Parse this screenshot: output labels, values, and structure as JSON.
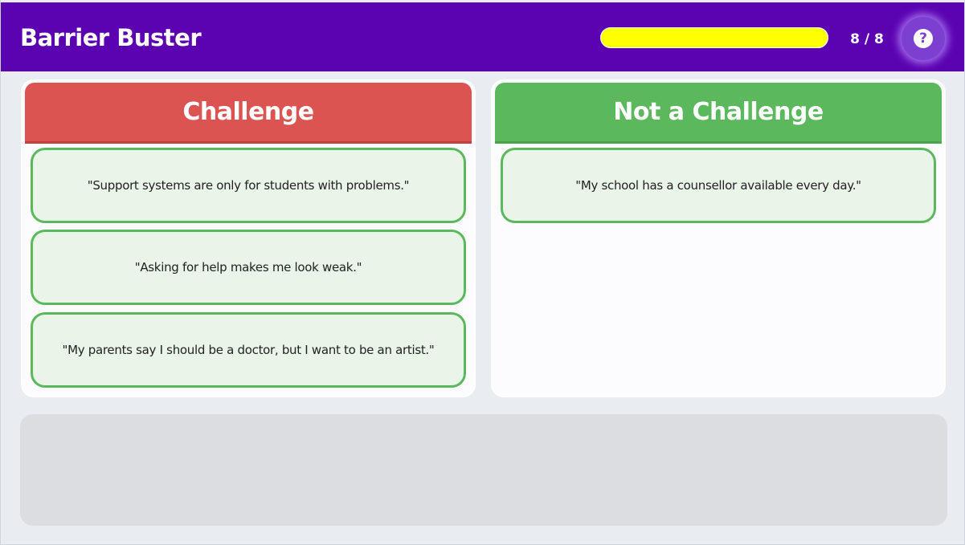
{
  "header": {
    "title": "Barrier Buster",
    "score": "8 / 8",
    "progress_fraction": 1.0,
    "help_icon": "question-circle-icon"
  },
  "columns": {
    "challenge": {
      "heading": "Challenge",
      "cards": [
        "\"Support systems are only for students with problems.\"",
        "\"Asking for help makes me look weak.\"",
        "\"My parents say I should be a doctor, but I want to be an artist.\""
      ]
    },
    "not_challenge": {
      "heading": "Not a Challenge",
      "cards": [
        "\"My school has a counsellor available every day.\""
      ]
    }
  },
  "colors": {
    "header_bg": "#5b03b1",
    "progress_fill": "#ffff00",
    "challenge_header": "#dc5451",
    "not_challenge_header": "#5cb85c",
    "card_bg": "#e8f5e8",
    "card_border": "#5cb85c"
  }
}
